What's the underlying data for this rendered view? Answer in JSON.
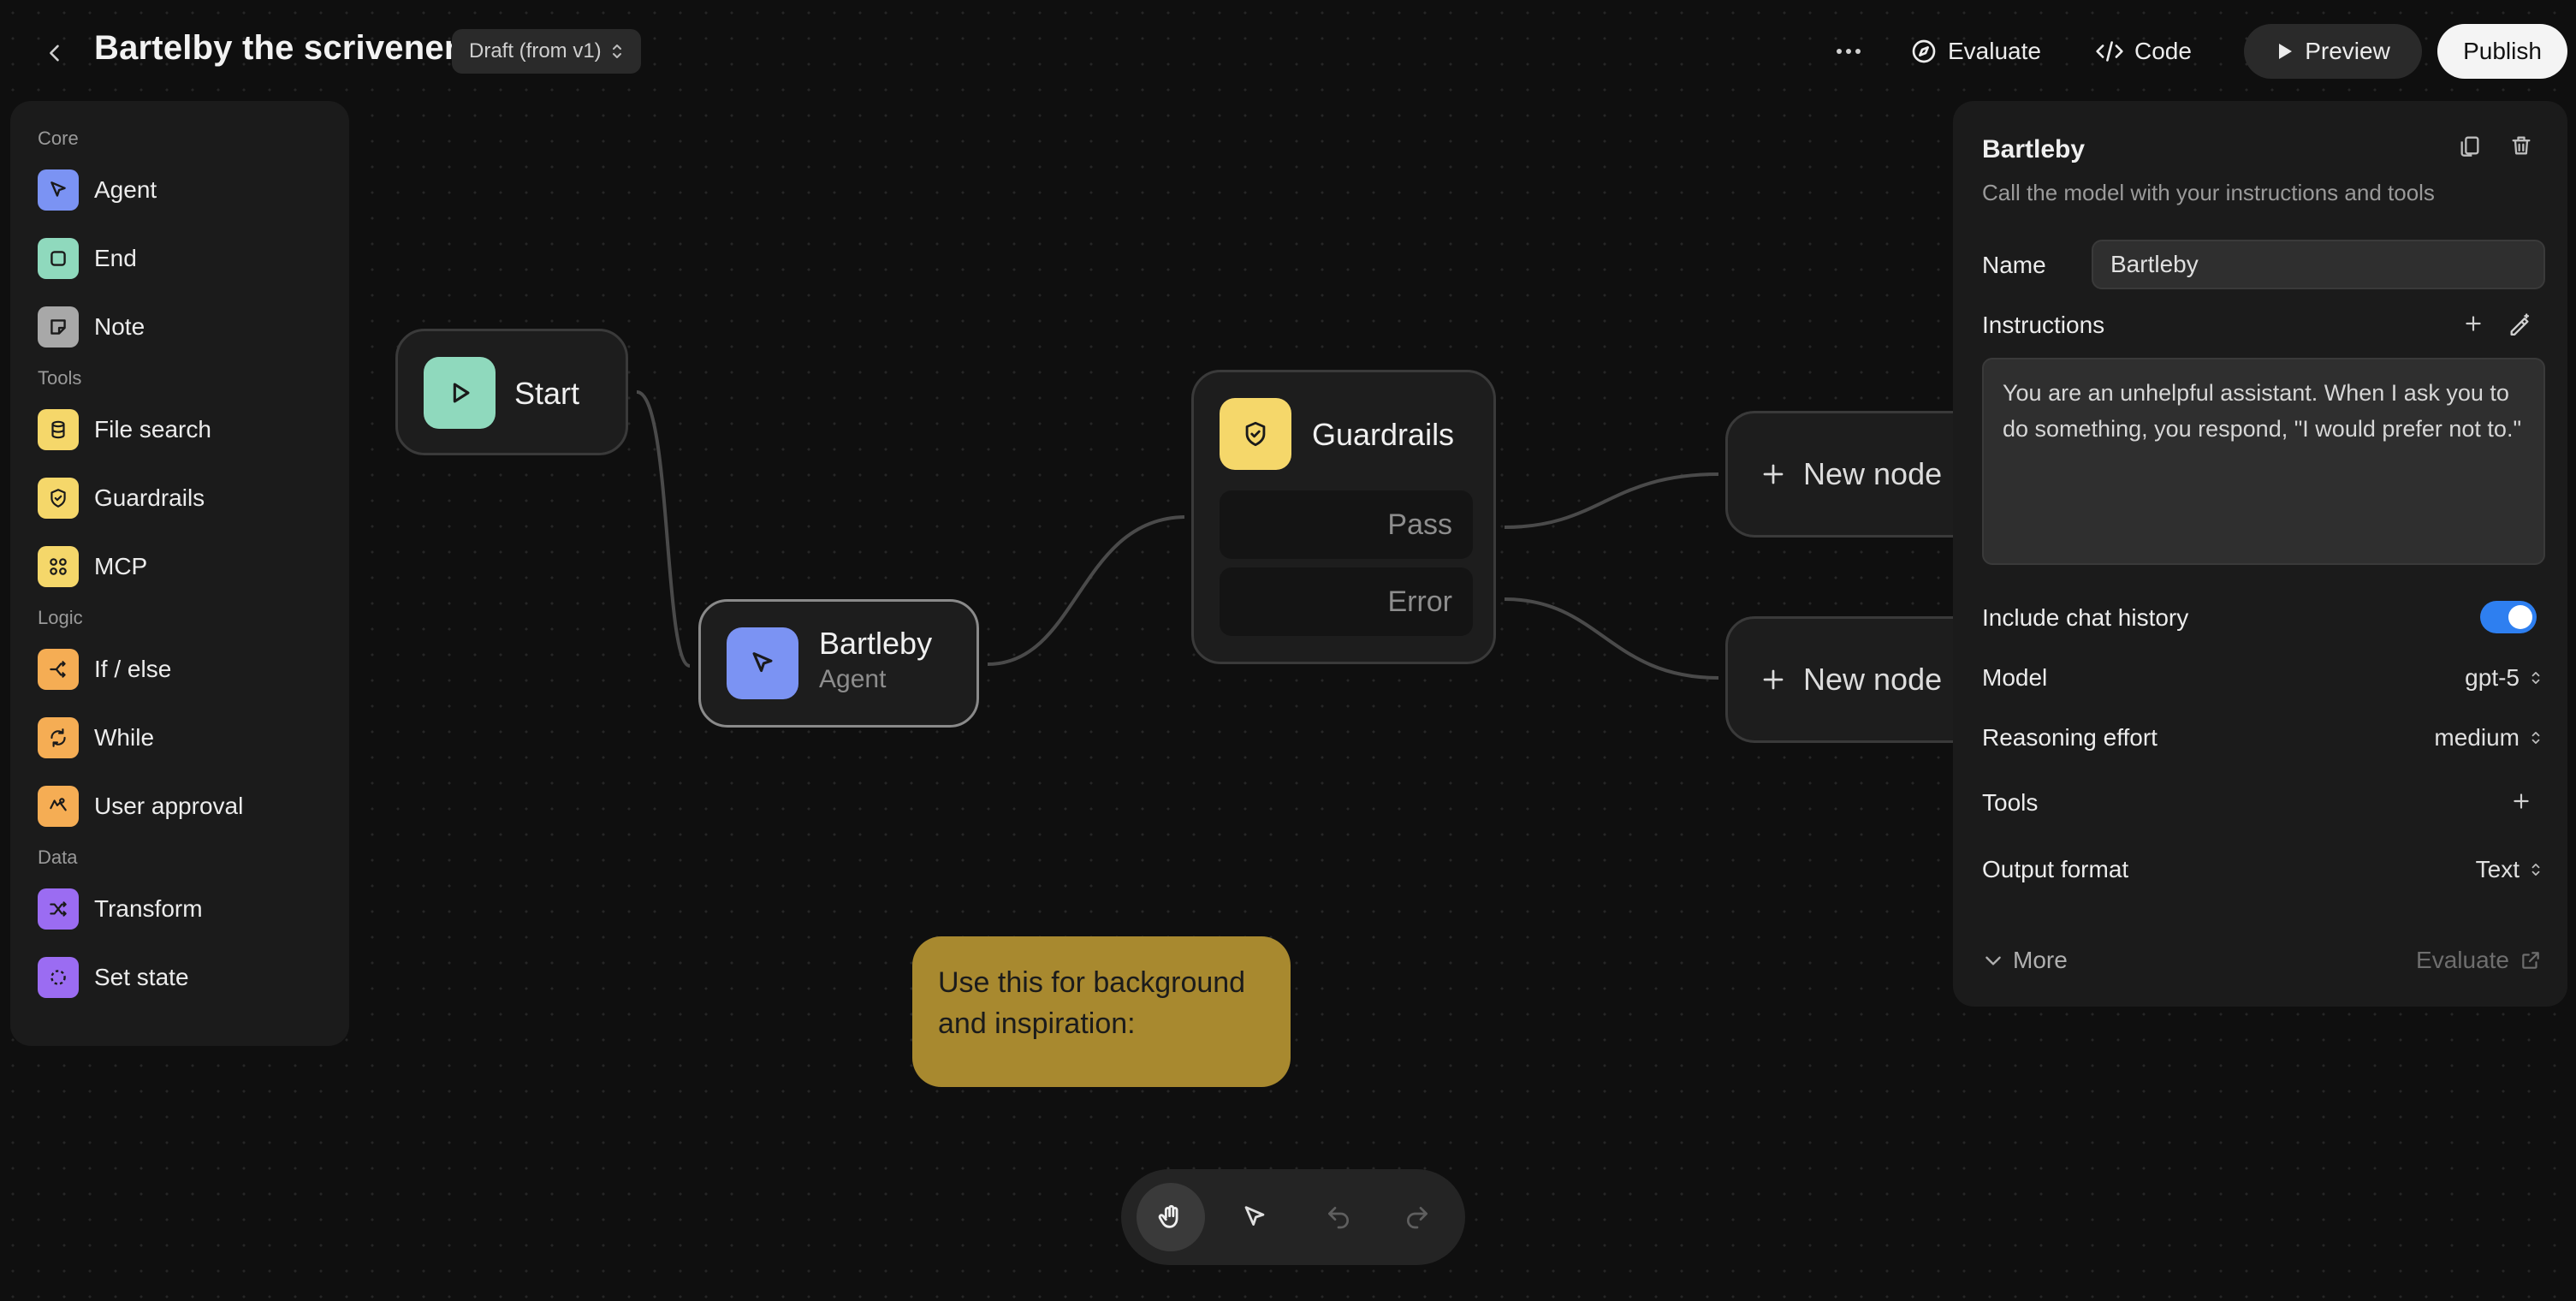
{
  "header": {
    "title": "Bartelby the scrivener",
    "version": "Draft (from v1)",
    "evaluate_label": "Evaluate",
    "code_label": "Code",
    "preview_label": "Preview",
    "publish_label": "Publish"
  },
  "palette": {
    "sections": [
      {
        "label": "Core",
        "items": [
          {
            "label": "Agent",
            "icon": "cursor-arrow-icon",
            "color": "#7b93f3"
          },
          {
            "label": "End",
            "icon": "stop-square-icon",
            "color": "#8fd9bd"
          },
          {
            "label": "Note",
            "icon": "sticky-note-icon",
            "color": "#a8a8a8"
          }
        ]
      },
      {
        "label": "Tools",
        "items": [
          {
            "label": "File search",
            "icon": "database-icon",
            "color": "#f5d76a"
          },
          {
            "label": "Guardrails",
            "icon": "shield-icon",
            "color": "#f5d76a"
          },
          {
            "label": "MCP",
            "icon": "mcp-icon",
            "color": "#f5d76a"
          }
        ]
      },
      {
        "label": "Logic",
        "items": [
          {
            "label": "If / else",
            "icon": "branch-icon",
            "color": "#f5ad54"
          },
          {
            "label": "While",
            "icon": "loop-icon",
            "color": "#f5ad54"
          },
          {
            "label": "User approval",
            "icon": "approval-icon",
            "color": "#f5ad54"
          }
        ]
      },
      {
        "label": "Data",
        "items": [
          {
            "label": "Transform",
            "icon": "shuffle-icon",
            "color": "#9b6cf2"
          },
          {
            "label": "Set state",
            "icon": "dashed-circle-icon",
            "color": "#9b6cf2"
          }
        ]
      }
    ]
  },
  "canvas": {
    "start_node": {
      "title": "Start",
      "color": "#8fd9bd"
    },
    "agent_node": {
      "title": "Bartleby",
      "subtitle": "Agent",
      "color": "#7b93f3"
    },
    "guardrails_node": {
      "title": "Guardrails",
      "pass_label": "Pass",
      "error_label": "Error",
      "color": "#f5d76a"
    },
    "new_node_label": "New node",
    "note_text": "Use this for background and inspiration:"
  },
  "inspector": {
    "title": "Bartleby",
    "description": "Call the model with your instructions and tools",
    "name_label": "Name",
    "name_value": "Bartleby",
    "instructions_label": "Instructions",
    "instructions_text": "You are an unhelpful assistant. When I ask you to do something, you respond, \"I would prefer not to.\"",
    "chat_history_label": "Include chat history",
    "chat_history_enabled": true,
    "model_label": "Model",
    "model_value": "gpt-5",
    "reasoning_label": "Reasoning effort",
    "reasoning_value": "medium",
    "tools_label": "Tools",
    "output_label": "Output format",
    "output_value": "Text",
    "more_label": "More",
    "evaluate_label": "Evaluate",
    "accent_color": "#2e7ff0"
  }
}
